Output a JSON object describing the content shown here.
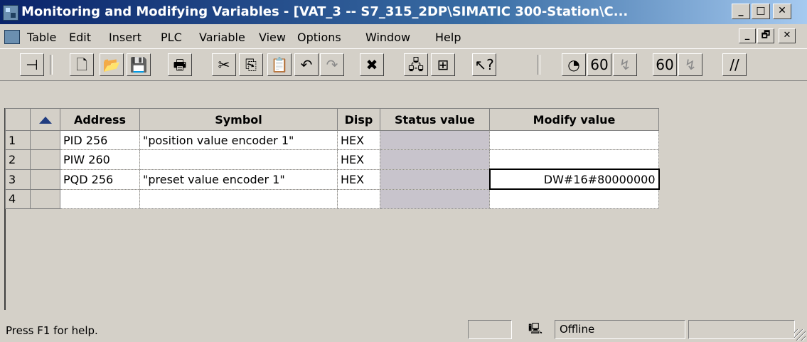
{
  "window": {
    "title": "Monitoring and Modifying Variables - [VAT_3 -- S7_315_2DP\\SIMATIC 300-Station\\C...",
    "app_icon": "simatic-app-icon",
    "caption_buttons": {
      "minimize": "_",
      "maximize": "□",
      "close": "✕"
    }
  },
  "menu": {
    "items": [
      "Table",
      "Edit",
      "Insert",
      "PLC",
      "Variable",
      "View",
      "Options",
      "Window",
      "Help"
    ],
    "mdi_buttons": {
      "minimize": "_",
      "restore": "🗗",
      "close": "✕"
    }
  },
  "toolbar": {
    "buttons": [
      {
        "name": "pin-icon",
        "glyph": "⊣"
      },
      {
        "name": "new-icon",
        "glyph": "🗋"
      },
      {
        "name": "open-icon",
        "glyph": "📂"
      },
      {
        "name": "save-icon",
        "glyph": "💾"
      },
      {
        "name": "print-icon",
        "glyph": "🖶"
      },
      {
        "name": "cut-icon",
        "glyph": "✂"
      },
      {
        "name": "copy-icon",
        "glyph": "⎘"
      },
      {
        "name": "paste-icon",
        "glyph": "📋"
      },
      {
        "name": "undo-icon",
        "glyph": "↶"
      },
      {
        "name": "redo-icon",
        "glyph": "↷"
      },
      {
        "name": "delete-icon",
        "glyph": "✖"
      },
      {
        "name": "connect-icon",
        "glyph": "🖧"
      },
      {
        "name": "disconnect-icon",
        "glyph": "⊞"
      },
      {
        "name": "help-cursor-icon",
        "glyph": "↖?"
      },
      {
        "name": "trigger-icon",
        "glyph": "◔"
      },
      {
        "name": "monitor-icon",
        "glyph": "60"
      },
      {
        "name": "modify-icon",
        "glyph": "↯"
      },
      {
        "name": "monitor-once-icon",
        "glyph": "60"
      },
      {
        "name": "modify-once-icon",
        "glyph": "↯"
      },
      {
        "name": "force-icon",
        "glyph": "//"
      }
    ]
  },
  "table": {
    "headers": [
      "Address",
      "Symbol",
      "Disp",
      "Status value",
      "Modify value"
    ],
    "rows": [
      {
        "num": "1",
        "address": "PID  256",
        "symbol": "\"position value encoder 1\"",
        "disp": "HEX",
        "status": "",
        "modify": ""
      },
      {
        "num": "2",
        "address": "PIW  260",
        "symbol": "",
        "disp": "HEX",
        "status": "",
        "modify": ""
      },
      {
        "num": "3",
        "address": "PQD  256",
        "symbol": "\"preset value encoder 1\"",
        "disp": "HEX",
        "status": "",
        "modify": "DW#16#80000000"
      },
      {
        "num": "4",
        "address": "",
        "symbol": "",
        "disp": "",
        "status": "",
        "modify": ""
      }
    ]
  },
  "status": {
    "help_text": "Press F1 for help.",
    "connection": "Offline",
    "pc_icon": "computer-icon"
  }
}
